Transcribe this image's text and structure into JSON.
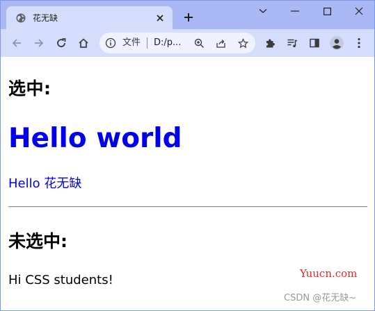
{
  "browser": {
    "tab": {
      "title": "花无缺"
    },
    "address_bar": {
      "security_label": "文件",
      "url": "D:/p..."
    }
  },
  "page": {
    "selected_heading": "选中:",
    "hello_heading": "Hello world",
    "hello_paragraph": "Hello 花无缺",
    "unselected_heading": "未选中:",
    "hi_paragraph": "Hi CSS students!"
  },
  "watermarks": {
    "site": "Yuucn.com",
    "csdn": "CSDN @花无缺~"
  },
  "colors": {
    "tabstrip": "#a8b9f5",
    "toolbar": "#d4ddfc",
    "link_blue": "#0000ee",
    "watermark_red": "#e2282b"
  },
  "icons": {
    "tab_favicon": "globe-icon",
    "tab_close": "close-icon",
    "new_tab": "plus-icon",
    "back": "arrow-left-icon",
    "forward": "arrow-right-icon",
    "reload": "reload-icon",
    "home": "home-icon",
    "zoom": "zoom-icon",
    "share": "share-icon",
    "bookmark": "star-icon",
    "extensions": "puzzle-icon",
    "reading_list": "reading-list-icon",
    "side_panel": "side-panel-icon",
    "profile": "avatar-icon",
    "menu": "kebab-menu-icon"
  }
}
